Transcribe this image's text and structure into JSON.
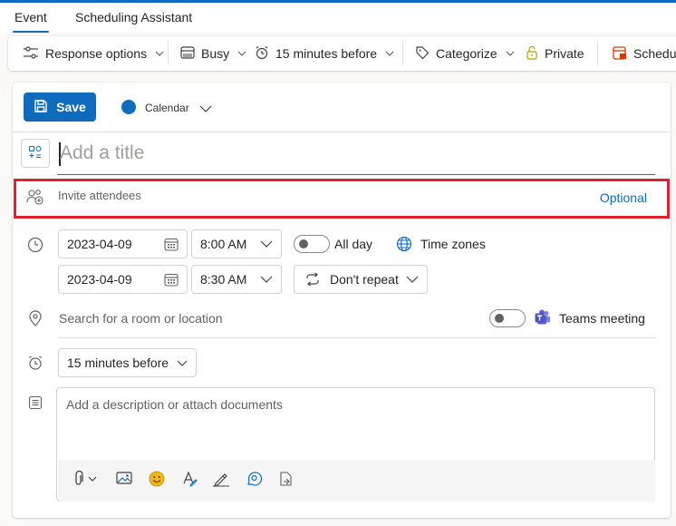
{
  "tabs": [
    {
      "label": "Event",
      "active": true
    },
    {
      "label": "Scheduling Assistant",
      "active": false
    }
  ],
  "toolbar": {
    "response_options": "Response options",
    "busy": "Busy",
    "reminder": "15 minutes before",
    "categorize": "Categorize",
    "private": "Private",
    "schedule": "Schedul"
  },
  "editor": {
    "save_label": "Save",
    "calendar_label": "Calendar",
    "title_placeholder": "Add a title",
    "invite_placeholder": "Invite attendees",
    "optional_label": "Optional",
    "start_date": "2023-04-09",
    "start_time": "8:00 AM",
    "end_date": "2023-04-09",
    "end_time": "8:30 AM",
    "all_day_label": "All day",
    "all_day_on": false,
    "time_zones_label": "Time zones",
    "repeat_label": "Don't repeat",
    "location_placeholder": "Search for a room or location",
    "teams_label": "Teams meeting",
    "teams_on": false,
    "reminder_label": "15 minutes before",
    "description_placeholder": "Add a description or attach documents"
  },
  "description_toolbar": [
    "attach-icon",
    "image-icon",
    "emoji-icon",
    "format-icon",
    "draw-icon",
    "loop-icon",
    "insert-icon"
  ],
  "colors": {
    "accent": "#0f6cbd",
    "highlight_border": "#e0202e",
    "teams_purple": "#5b5fc7",
    "emoji_yellow": "#f2b81b"
  }
}
